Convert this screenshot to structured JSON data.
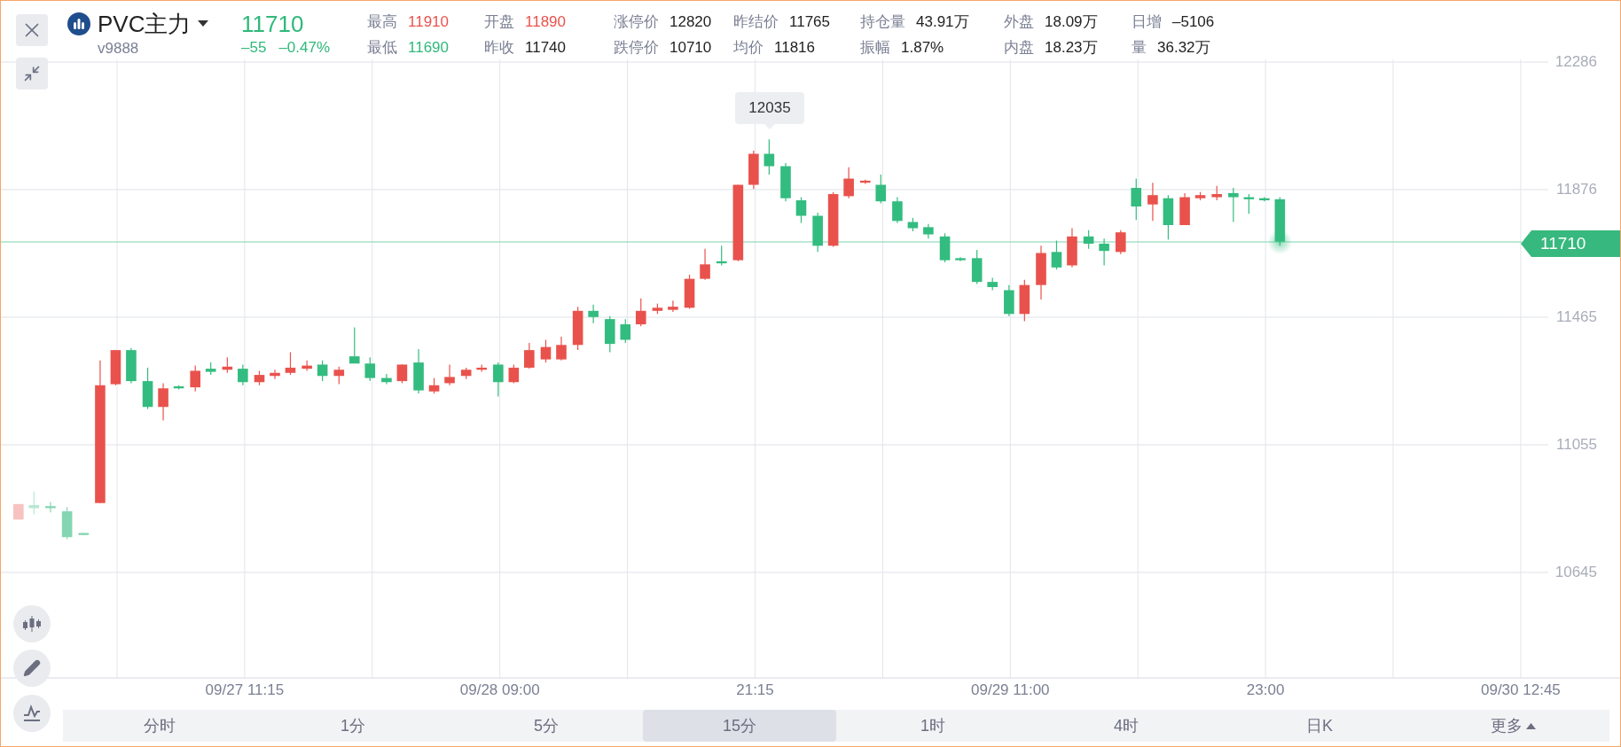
{
  "symbol": {
    "name": "PVC主力",
    "code": "v9888",
    "price": "11710",
    "change": "–55",
    "change_pct": "–0.47%",
    "color": "#2fb97a"
  },
  "stats": [
    [
      {
        "label": "最高",
        "value": "11910",
        "color": "#e9524c"
      },
      {
        "label": "最低",
        "value": "11690",
        "color": "#2fb97a"
      }
    ],
    [
      {
        "label": "开盘",
        "value": "11890",
        "color": "#e9524c"
      },
      {
        "label": "昨收",
        "value": "11740",
        "color": "#222222"
      }
    ],
    [
      {
        "label": "涨停价",
        "value": "12820",
        "color": "#222222"
      },
      {
        "label": "跌停价",
        "value": "10710",
        "color": "#222222"
      }
    ],
    [
      {
        "label": "昨结价",
        "value": "11765",
        "color": "#222222"
      },
      {
        "label": "均价",
        "value": "11816",
        "color": "#222222"
      }
    ],
    [
      {
        "label": "持仓量",
        "value": "43.91万",
        "color": "#222222"
      },
      {
        "label": "振幅",
        "value": "1.87%",
        "color": "#222222"
      }
    ],
    [
      {
        "label": "外盘",
        "value": "18.09万",
        "color": "#222222"
      },
      {
        "label": "内盘",
        "value": "18.23万",
        "color": "#222222"
      }
    ],
    [
      {
        "label": "日增",
        "value": "–5106",
        "color": "#222222"
      },
      {
        "label": "量",
        "value": "36.32万",
        "color": "#222222"
      }
    ]
  ],
  "chart": {
    "y_labels": [
      "12286",
      "11876",
      "11465",
      "11055",
      "10645"
    ],
    "x_labels": [
      "09/27 11:15",
      "09/28 09:00",
      "21:15",
      "09/29 11:00",
      "23:00",
      "09/30 12:45"
    ],
    "tooltip": "12035",
    "last_price_tag": "11710"
  },
  "timeframes": [
    {
      "label": "分时",
      "selected": false
    },
    {
      "label": "1分",
      "selected": false
    },
    {
      "label": "5分",
      "selected": false
    },
    {
      "label": "15分",
      "selected": true
    },
    {
      "label": "1时",
      "selected": false
    },
    {
      "label": "4时",
      "selected": false
    },
    {
      "label": "日K",
      "selected": false
    },
    {
      "label": "更多",
      "selected": false,
      "kind": "menu"
    }
  ]
}
